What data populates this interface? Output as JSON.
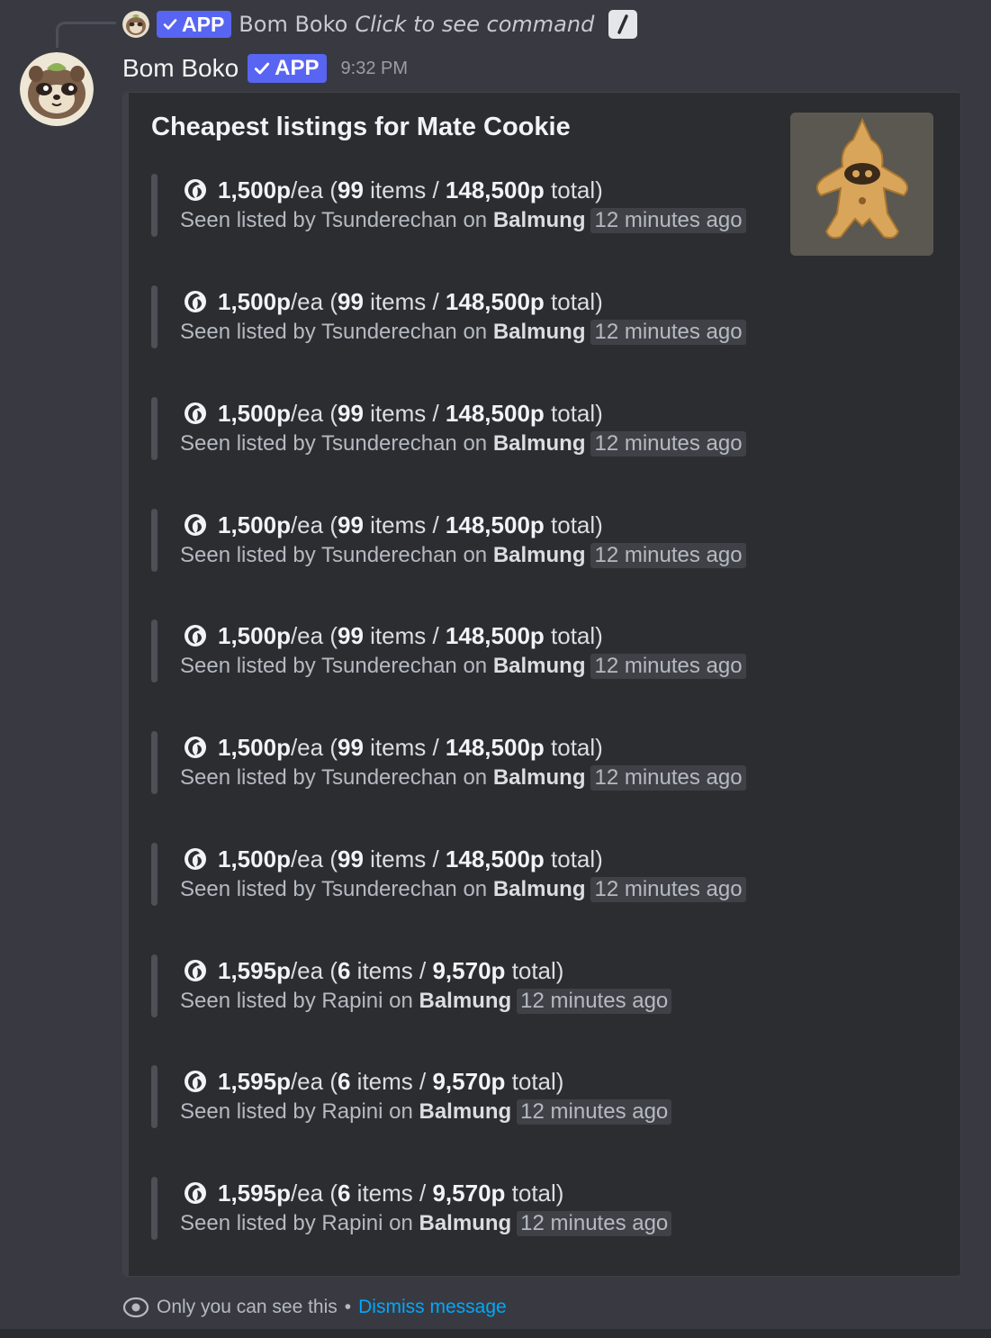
{
  "reply": {
    "badge": "APP",
    "author": "Bom Boko",
    "command_text": "Click to see command",
    "icons": [
      "avatar-mini",
      "check-icon",
      "slash-command-icon"
    ]
  },
  "message": {
    "author": "Bom Boko",
    "badge": "APP",
    "timestamp": "9:32 PM"
  },
  "embed": {
    "title": "Cheapest listings for Mate Cookie",
    "thumbnail": "mate-cookie-image",
    "listings": [
      {
        "price": "1,500p",
        "per": "/ea (",
        "qty": "99",
        "items_label": " items / ",
        "total": "148,500p",
        "total_label": " total)",
        "seen_prefix": "Seen listed by Tsunderechan on ",
        "world": "Balmung",
        "ago": "12 minutes ago"
      },
      {
        "price": "1,500p",
        "per": "/ea (",
        "qty": "99",
        "items_label": " items / ",
        "total": "148,500p",
        "total_label": " total)",
        "seen_prefix": "Seen listed by Tsunderechan on ",
        "world": "Balmung",
        "ago": "12 minutes ago"
      },
      {
        "price": "1,500p",
        "per": "/ea (",
        "qty": "99",
        "items_label": " items / ",
        "total": "148,500p",
        "total_label": " total)",
        "seen_prefix": "Seen listed by Tsunderechan on ",
        "world": "Balmung",
        "ago": "12 minutes ago"
      },
      {
        "price": "1,500p",
        "per": "/ea (",
        "qty": "99",
        "items_label": " items / ",
        "total": "148,500p",
        "total_label": " total)",
        "seen_prefix": "Seen listed by Tsunderechan on ",
        "world": "Balmung",
        "ago": "12 minutes ago"
      },
      {
        "price": "1,500p",
        "per": "/ea (",
        "qty": "99",
        "items_label": " items / ",
        "total": "148,500p",
        "total_label": " total)",
        "seen_prefix": "Seen listed by Tsunderechan on ",
        "world": "Balmung",
        "ago": "12 minutes ago"
      },
      {
        "price": "1,500p",
        "per": "/ea (",
        "qty": "99",
        "items_label": " items / ",
        "total": "148,500p",
        "total_label": " total)",
        "seen_prefix": "Seen listed by Tsunderechan on ",
        "world": "Balmung",
        "ago": "12 minutes ago"
      },
      {
        "price": "1,500p",
        "per": "/ea (",
        "qty": "99",
        "items_label": " items / ",
        "total": "148,500p",
        "total_label": " total)",
        "seen_prefix": "Seen listed by Tsunderechan on ",
        "world": "Balmung",
        "ago": "12 minutes ago"
      },
      {
        "price": "1,595p",
        "per": "/ea (",
        "qty": "6",
        "items_label": " items / ",
        "total": "9,570p",
        "total_label": " total)",
        "seen_prefix": "Seen listed by Rapini on ",
        "world": "Balmung",
        "ago": "12 minutes ago"
      },
      {
        "price": "1,595p",
        "per": "/ea (",
        "qty": "6",
        "items_label": " items / ",
        "total": "9,570p",
        "total_label": " total)",
        "seen_prefix": "Seen listed by Rapini on ",
        "world": "Balmung",
        "ago": "12 minutes ago"
      },
      {
        "price": "1,595p",
        "per": "/ea (",
        "qty": "6",
        "items_label": " items / ",
        "total": "9,570p",
        "total_label": " total)",
        "seen_prefix": "Seen listed by Rapini on ",
        "world": "Balmung",
        "ago": "12 minutes ago"
      }
    ]
  },
  "footer": {
    "notice": "Only you can see this",
    "separator": "•",
    "dismiss": "Dismiss message"
  },
  "colors": {
    "background": "#393a41",
    "embed_background": "#2b2d31",
    "badge": "#5865f2",
    "link": "#00a8fc"
  }
}
